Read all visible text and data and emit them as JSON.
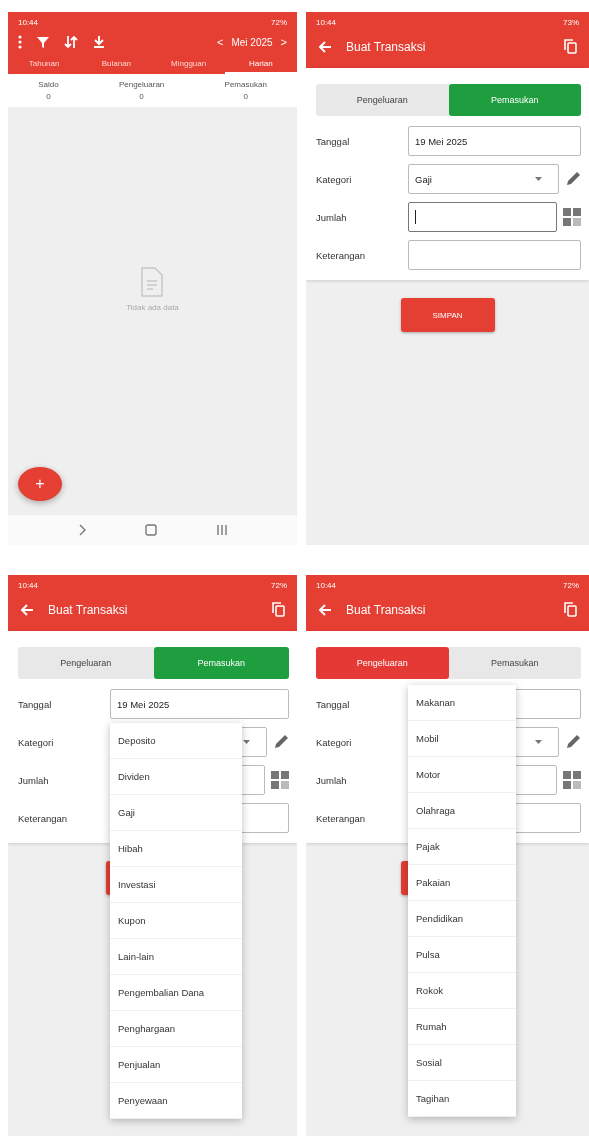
{
  "screens": [
    {
      "kind": "list",
      "status": {
        "time": "10:44",
        "battery": "72%"
      },
      "month": "Mei 2025",
      "prev": "<",
      "next": ">",
      "tabs": [
        {
          "label": "Tahunan",
          "selected": false
        },
        {
          "label": "Bulanan",
          "selected": false
        },
        {
          "label": "Mingguan",
          "selected": false
        },
        {
          "label": "Harian",
          "selected": true
        }
      ],
      "summary": [
        {
          "label": "Saldo",
          "value": "0"
        },
        {
          "label": "Pengeluaran",
          "value": "0"
        },
        {
          "label": "Pemasukan",
          "value": "0"
        }
      ],
      "empty_text": "Tidak ada data",
      "fab": "+"
    },
    {
      "kind": "form",
      "status": {
        "time": "10:44",
        "battery": "73%"
      },
      "title": "Buat Transaksi",
      "types": [
        {
          "label": "Pengeluaran",
          "selected": false
        },
        {
          "label": "Pemasukan",
          "selected": true,
          "color": "#1e9e3e"
        }
      ],
      "fields": [
        {
          "kind": "text",
          "label": "Tanggal",
          "value": "19 Mei 2025"
        },
        {
          "kind": "select",
          "label": "Kategori",
          "value": "Gaji"
        },
        {
          "kind": "number",
          "label": "Jumlah",
          "focused": true
        },
        {
          "kind": "text",
          "label": "Keterangan"
        }
      ],
      "button": {
        "visible": true,
        "label": "SIMPAN"
      }
    },
    {
      "kind": "form",
      "status": {
        "time": "10:44",
        "battery": "72%"
      },
      "title": "Buat Transaksi",
      "types": [
        {
          "label": "Pengeluaran",
          "selected": false
        },
        {
          "label": "Pemasukan",
          "selected": true,
          "color": "#1e9e3e"
        }
      ],
      "fields": [
        {
          "kind": "text",
          "label": "Tanggal",
          "value": "19 Mei 2025"
        },
        {
          "kind": "select",
          "label": "Kategori",
          "open": true,
          "options": [
            "Deposito",
            "Dividen",
            "Gaji",
            "Hibah",
            "Investasi",
            "Kupon",
            "Lain-lain",
            "Pengembalian Dana",
            "Penghargaan",
            "Penjualan",
            "Penyewaan"
          ]
        },
        {
          "kind": "number",
          "label": "Jumlah",
          "focused": false
        },
        {
          "kind": "text",
          "label": "Keterangan"
        }
      ],
      "button": {
        "visible": true
      }
    },
    {
      "kind": "form",
      "status": {
        "time": "10:44",
        "battery": "72%"
      },
      "title": "Buat Transaksi",
      "types": [
        {
          "label": "Pengeluaran",
          "selected": true,
          "color": "#e53935"
        },
        {
          "label": "Pemasukan",
          "selected": false
        }
      ],
      "fields": [
        {
          "kind": "text",
          "label": "Tanggal"
        },
        {
          "kind": "select",
          "label": "Kategori",
          "open": true,
          "menu_raised": true,
          "options": [
            "Makanan",
            "Mobil",
            "Motor",
            "Olahraga",
            "Pajak",
            "Pakaian",
            "Pendidikan",
            "Pulsa",
            "Rokok",
            "Rumah",
            "Sosial",
            "Tagihan"
          ]
        },
        {
          "kind": "number",
          "label": "Jumlah",
          "focused": false
        },
        {
          "kind": "text",
          "label": "Keterangan"
        }
      ],
      "button": {
        "visible": true
      }
    }
  ]
}
